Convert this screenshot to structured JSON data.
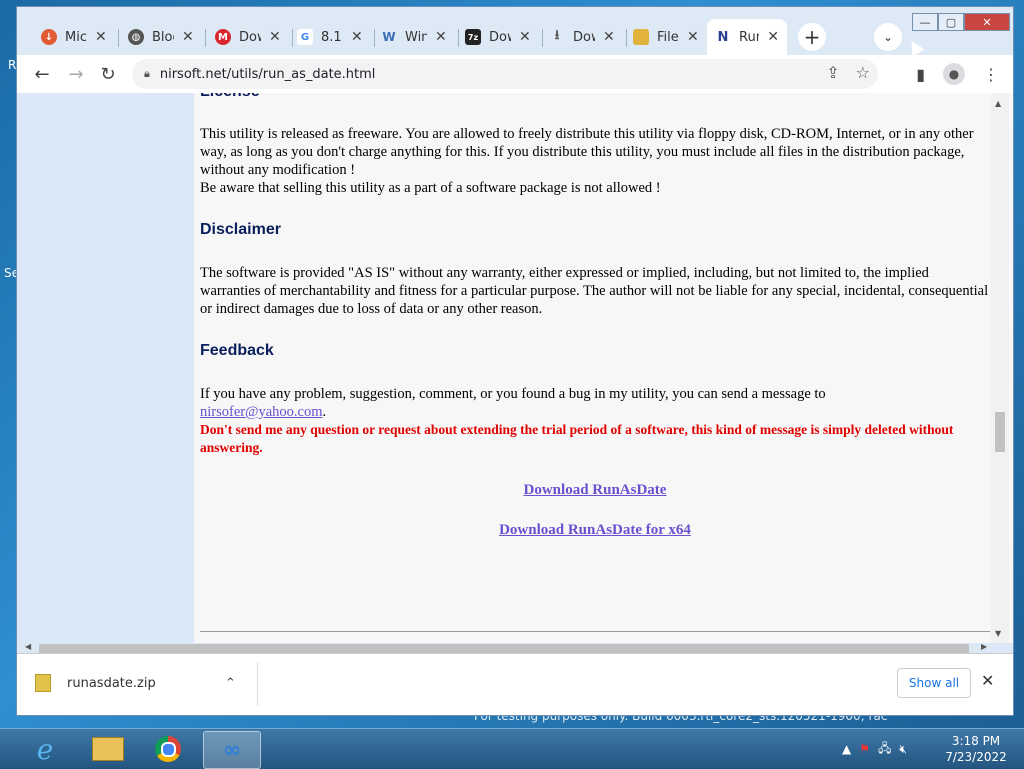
{
  "desktop": {
    "frag1": "R",
    "frag2": "Se",
    "watermark": "For testing purposes only. Build 6003.rtl_core2_sts.120521-1900; rac"
  },
  "tabs": [
    {
      "label": "Microsoft",
      "icon": "download-icon",
      "color": "#e15b34"
    },
    {
      "label": "Blog",
      "icon": "globe-icon",
      "color": "#555555"
    },
    {
      "label": "Download",
      "icon": "mega-icon",
      "color": "#d9272e"
    },
    {
      "label": "8.1",
      "icon": "google-icon",
      "color": "#4285f4"
    },
    {
      "label": "Windows",
      "icon": "w-icon",
      "color": "#3d6db5"
    },
    {
      "label": "Download",
      "icon": "7zip-icon",
      "color": "#222222"
    },
    {
      "label": "Download",
      "icon": "download-arrow-icon",
      "color": "#555555"
    },
    {
      "label": "Files",
      "icon": "folder-icon",
      "color": "#e2b33c"
    },
    {
      "label": "RunAsDate",
      "icon": "nirsoft-icon",
      "color": "#2a3f8f"
    }
  ],
  "address": {
    "url": "nirsoft.net/utils/run_as_date.html"
  },
  "article": {
    "license_heading": "License",
    "license_text": "This utility is released as freeware. You are allowed to freely distribute this utility via floppy disk, CD-ROM, Internet, or in any other way, as long as you don't charge anything for this. If you distribute this utility, you must include all files in the distribution package, without any modification !",
    "license_text2": "Be aware that selling this utility as a part of a software package is not allowed !",
    "disclaimer_heading": "Disclaimer",
    "disclaimer_text": "The software is provided \"AS IS\" without any warranty, either expressed or implied, including, but not limited to, the implied warranties of merchantability and fitness for a particular purpose. The author will not be liable for any special, incidental, consequential or indirect damages due to loss of data or any other reason.",
    "feedback_heading": "Feedback",
    "feedback_text": "If you have any problem, suggestion, comment, or you found a bug in my utility, you can send a message to",
    "feedback_email": "nirsofer@yahoo.com",
    "feedback_period": ".",
    "warning": "Don't send me any question or request about extending the trial period of a software, this kind of message is simply deleted without answering.",
    "download1": "Download RunAsDate",
    "download2": "Download RunAsDate for x64"
  },
  "downloads": {
    "filename": "runasdate.zip",
    "show_all": "Show all"
  },
  "taskbar": {
    "time": "3:18 PM",
    "date": "7/23/2022"
  }
}
